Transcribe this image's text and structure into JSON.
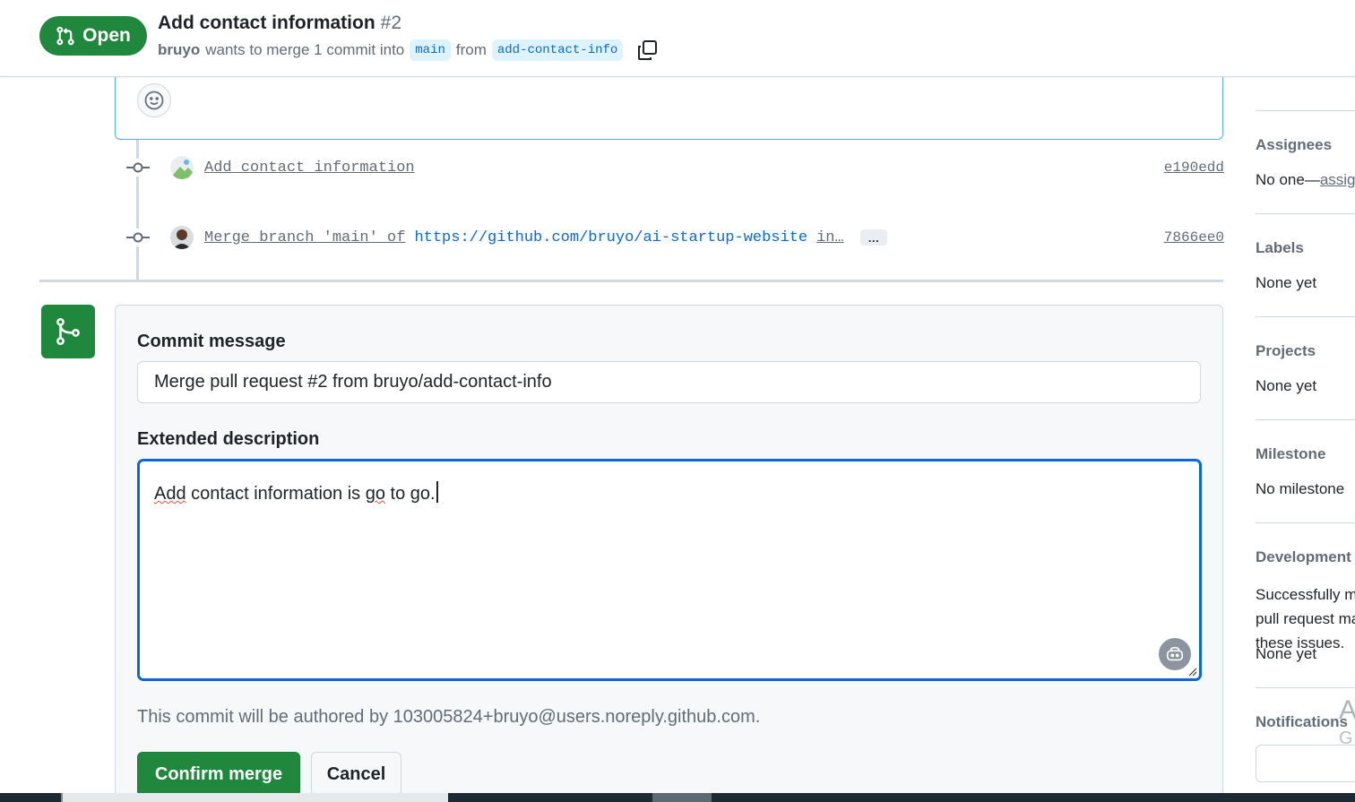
{
  "header": {
    "state": "Open",
    "title": "Add contact information",
    "number": "#2",
    "author": "bruyo",
    "merge_text": "wants to merge 1 commit into",
    "base_branch": "main",
    "from_text": "from",
    "head_branch": "add-contact-info"
  },
  "timeline": {
    "commits": [
      {
        "message": "Add contact information",
        "sha": "e190edd"
      },
      {
        "message": "Merge branch 'main' of",
        "link": "https://github.com/bruyo/ai-startup-website",
        "trail": "in…",
        "more": "…",
        "sha": "7866ee0"
      }
    ]
  },
  "merge": {
    "commit_label": "Commit message",
    "commit_value": "Merge pull request #2 from bruyo/add-contact-info",
    "desc_label": "Extended description",
    "desc_word1": "Add",
    "desc_mid1": "contact information is",
    "desc_word2": "go",
    "desc_mid2": "to go.",
    "author_note": "This commit will be authored by 103005824+bruyo@users.noreply.github.com.",
    "confirm_label": "Confirm merge",
    "cancel_label": "Cancel"
  },
  "sidebar": {
    "assignees_heading": "Assignees",
    "assignees_value": "No one—",
    "assignees_link": "assign yourself",
    "labels_heading": "Labels",
    "labels_value": "None yet",
    "projects_heading": "Projects",
    "projects_value": "None yet",
    "milestone_heading": "Milestone",
    "milestone_value": "No milestone",
    "development_heading": "Development",
    "development_text": "Successfully merging this pull request may close these issues.",
    "development_value": "None yet",
    "notifications_heading": "Notifications"
  },
  "overlay": {
    "letter_a": "A",
    "letter_g": "G"
  },
  "colors": {
    "green": "#1f883d",
    "blue": "#0969da",
    "muted": "#636c76",
    "border": "#d0d7de"
  },
  "icons": [
    "git-pull-request-icon",
    "copy-icon",
    "smiley-icon",
    "git-commit-icon",
    "git-merge-icon",
    "copilot-icon"
  ]
}
